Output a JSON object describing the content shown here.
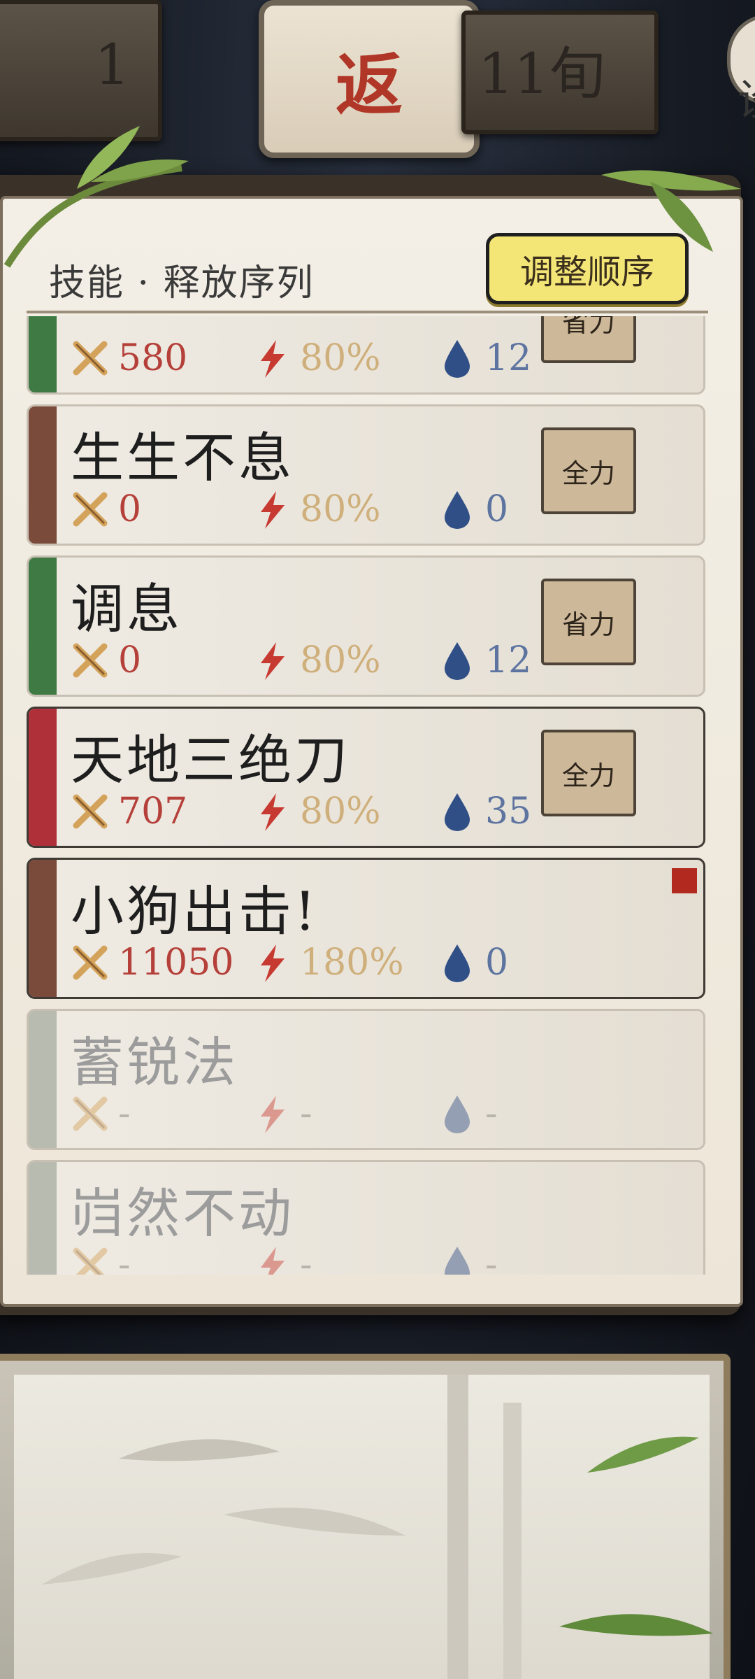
{
  "header": {
    "left_text": "1",
    "back_label": "返",
    "right_text": "11旬",
    "corner_text": "设"
  },
  "skills_panel": {
    "title": "技能 · 释放序列",
    "adjust_button_label": "调整顺序",
    "cards": [
      {
        "name": "",
        "attack": "580",
        "rate": "80%",
        "mana": "12",
        "mode": "省力",
        "color": "#3f7a45",
        "active": false,
        "inactive": false
      },
      {
        "name": "生生不息",
        "attack": "0",
        "rate": "80%",
        "mana": "0",
        "mode": "全力",
        "color": "#7a4a3a",
        "active": false,
        "inactive": false
      },
      {
        "name": "调息",
        "attack": "0",
        "rate": "80%",
        "mana": "12",
        "mode": "省力",
        "color": "#3f7a45",
        "active": false,
        "inactive": false
      },
      {
        "name": "天地三绝刀",
        "attack": "707",
        "rate": "80%",
        "mana": "35",
        "mode": "全力",
        "color": "#b0303a",
        "active": true,
        "inactive": false
      },
      {
        "name": "小狗出击!",
        "attack": "11050",
        "rate": "180%",
        "mana": "0",
        "mode": "",
        "color": "#7a4a3a",
        "active": true,
        "inactive": false,
        "marker": true
      },
      {
        "name": "蓄锐法",
        "attack": "-",
        "rate": "-",
        "mana": "-",
        "mode": "",
        "color": "#b7bbb0",
        "active": false,
        "inactive": true
      },
      {
        "name": "岿然不动",
        "attack": "-",
        "rate": "-",
        "mana": "-",
        "mode": "",
        "color": "#b7bbb0",
        "active": false,
        "inactive": true
      }
    ]
  },
  "colors": {
    "accent_yellow": "#f4e577",
    "attack_red": "#b5403a",
    "rate_gold": "#cfb07c",
    "mana_blue": "#5d74a0"
  },
  "icons": [
    "crossed-swords-icon",
    "lightning-icon",
    "water-drop-icon"
  ]
}
